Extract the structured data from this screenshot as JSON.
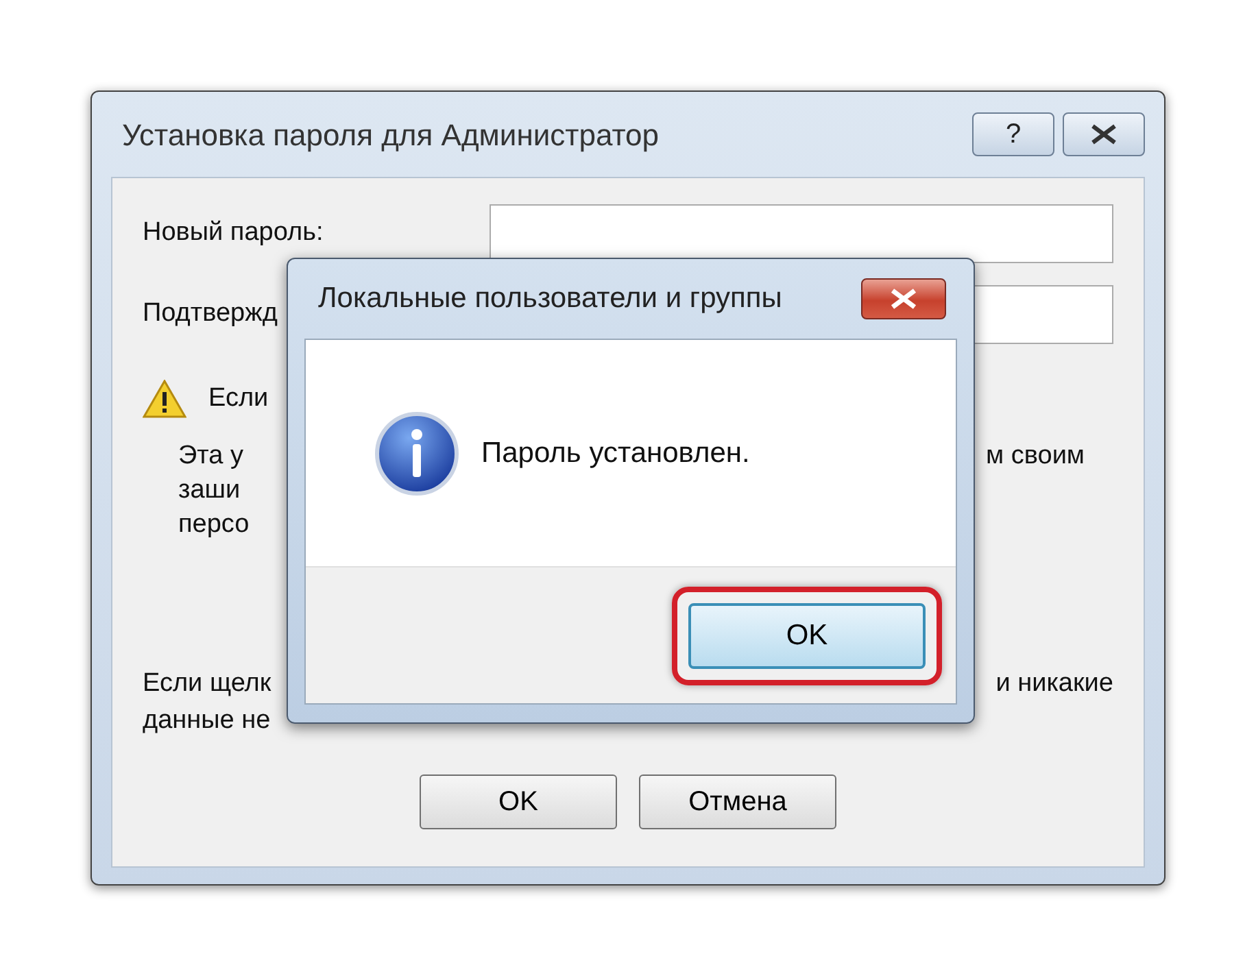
{
  "window": {
    "title": "Установка пароля для Администратор",
    "help_button": "?"
  },
  "fields": [
    {
      "label": "Новый пароль:"
    },
    {
      "label": "Подтвержд"
    }
  ],
  "warning": {
    "heading": "Если",
    "lines": [
      {
        "left": "Эта у",
        "right": "м своим"
      },
      {
        "left": "заши"
      },
      {
        "left": "персо"
      }
    ]
  },
  "note": {
    "lines": [
      {
        "left": "Если щелк",
        "right": "и никакие"
      },
      {
        "left": "данные не"
      }
    ]
  },
  "buttons": [
    "OK",
    "Отмена"
  ],
  "message_box": {
    "title": "Локальные пользователи и группы",
    "text": "Пароль установлен.",
    "button": {
      "label": "OK",
      "highlighted": true
    }
  }
}
